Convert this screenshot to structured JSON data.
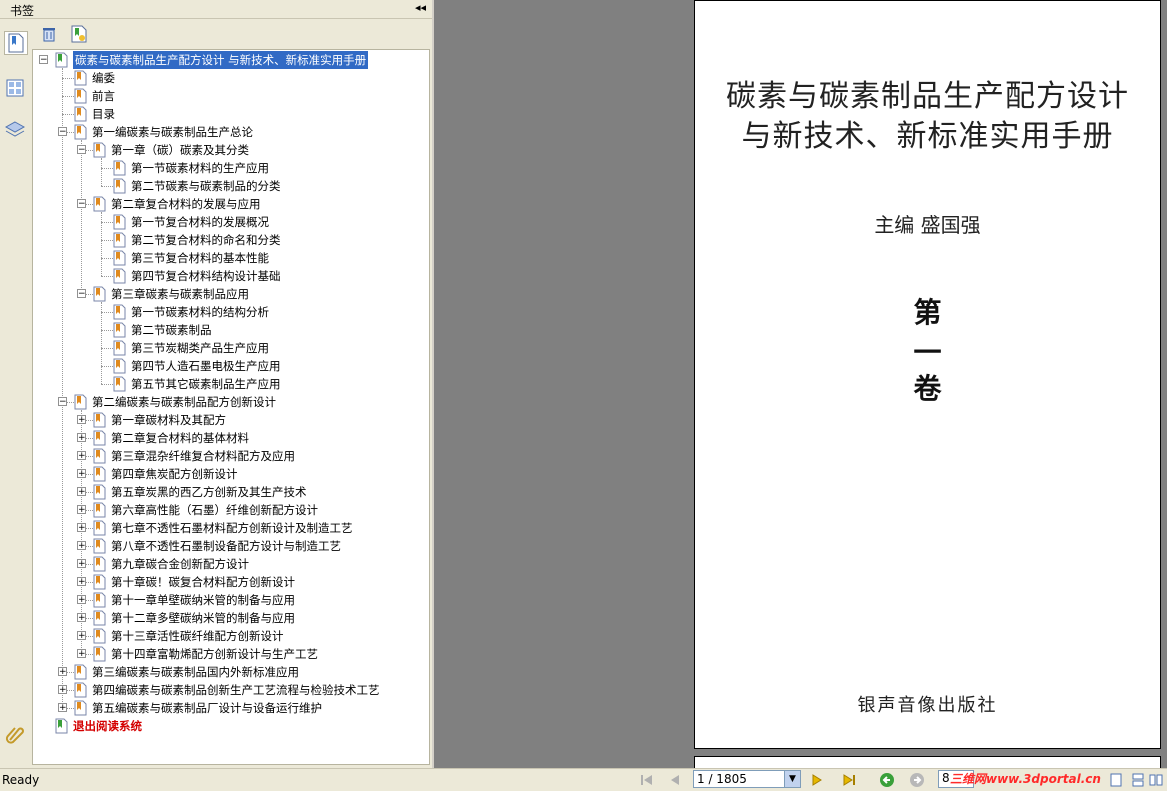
{
  "panel": {
    "title": "书签",
    "collapse_glyph": "◂◂"
  },
  "tree": [
    {
      "label": "碳素与碳素制品生产配方设计  与新技术、新标准实用手册",
      "level": 0,
      "exp": "minus",
      "selected": true
    },
    {
      "label": "编委",
      "level": 1,
      "exp": null
    },
    {
      "label": "前言",
      "level": 1,
      "exp": null
    },
    {
      "label": "目录",
      "level": 1,
      "exp": null
    },
    {
      "label": "第一编碳素与碳素制品生产总论",
      "level": 1,
      "exp": "minus"
    },
    {
      "label": "第一章（碳）碳素及其分类",
      "level": 2,
      "exp": "minus"
    },
    {
      "label": "第一节碳素材料的生产应用",
      "level": 3,
      "exp": null
    },
    {
      "label": "第二节碳素与碳素制品的分类",
      "level": 3,
      "exp": null
    },
    {
      "label": "第二章复合材料的发展与应用",
      "level": 2,
      "exp": "minus"
    },
    {
      "label": "第一节复合材料的发展概况",
      "level": 3,
      "exp": null
    },
    {
      "label": "第二节复合材料的命名和分类",
      "level": 3,
      "exp": null
    },
    {
      "label": "第三节复合材料的基本性能",
      "level": 3,
      "exp": null
    },
    {
      "label": "第四节复合材料结构设计基础",
      "level": 3,
      "exp": null
    },
    {
      "label": "第三章碳素与碳素制品应用",
      "level": 2,
      "exp": "minus"
    },
    {
      "label": "第一节碳素材料的结构分析",
      "level": 3,
      "exp": null
    },
    {
      "label": "第二节碳素制品",
      "level": 3,
      "exp": null
    },
    {
      "label": "第三节炭糊类产品生产应用",
      "level": 3,
      "exp": null
    },
    {
      "label": "第四节人造石墨电极生产应用",
      "level": 3,
      "exp": null
    },
    {
      "label": "第五节其它碳素制品生产应用",
      "level": 3,
      "exp": null
    },
    {
      "label": "第二编碳素与碳素制品配方创新设计",
      "level": 1,
      "exp": "minus"
    },
    {
      "label": "第一章碳材料及其配方",
      "level": 2,
      "exp": "plus"
    },
    {
      "label": "第二章复合材料的基体材料",
      "level": 2,
      "exp": "plus"
    },
    {
      "label": "第三章混杂纤维复合材料配方及应用",
      "level": 2,
      "exp": "plus"
    },
    {
      "label": "第四章焦炭配方创新设计",
      "level": 2,
      "exp": "plus"
    },
    {
      "label": "第五章炭黑的西乙方创新及其生产技术",
      "level": 2,
      "exp": "plus"
    },
    {
      "label": "第六章高性能（石墨）纤维创新配方设计",
      "level": 2,
      "exp": "plus"
    },
    {
      "label": "第七章不透性石墨材料配方创新设计及制造工艺",
      "level": 2,
      "exp": "plus"
    },
    {
      "label": "第八章不透性石墨制设备配方设计与制造工艺",
      "level": 2,
      "exp": "plus"
    },
    {
      "label": "第九章碳合金创新配方设计",
      "level": 2,
      "exp": "plus"
    },
    {
      "label": "第十章碳！碳复合材料配方创新设计",
      "level": 2,
      "exp": "plus"
    },
    {
      "label": "第十一章单壁碳纳米管的制备与应用",
      "level": 2,
      "exp": "plus"
    },
    {
      "label": "第十二章多壁碳纳米管的制备与应用",
      "level": 2,
      "exp": "plus"
    },
    {
      "label": "第十三章活性碳纤维配方创新设计",
      "level": 2,
      "exp": "plus"
    },
    {
      "label": "第十四章富勒烯配方创新设计与生产工艺",
      "level": 2,
      "exp": "plus"
    },
    {
      "label": "第三编碳素与碳素制品国内外新标准应用",
      "level": 1,
      "exp": "plus"
    },
    {
      "label": "第四编碳素与碳素制品创新生产工艺流程与检验技术工艺",
      "level": 1,
      "exp": "plus"
    },
    {
      "label": "第五编碳素与碳素制品厂设计与设备运行维护",
      "level": 1,
      "exp": "plus"
    },
    {
      "label": "退出阅读系统",
      "level": 0,
      "exp": null,
      "red": true
    }
  ],
  "page": {
    "title_line1": "碳素与碳素制品生产配方设计",
    "title_line2": "与新技术、新标准实用手册",
    "editor": "主编   盛国强",
    "volume": [
      "第",
      "一",
      "卷"
    ],
    "publisher": "银声音像出版社"
  },
  "status": {
    "text": "Ready",
    "page_indicator": "1 / 1805",
    "zoom": "8",
    "watermark": "三维网www.3dportal.cn"
  },
  "colors": {
    "selection": "#316ac5",
    "exit_text": "#d40000",
    "doc_bg": "#808080"
  }
}
